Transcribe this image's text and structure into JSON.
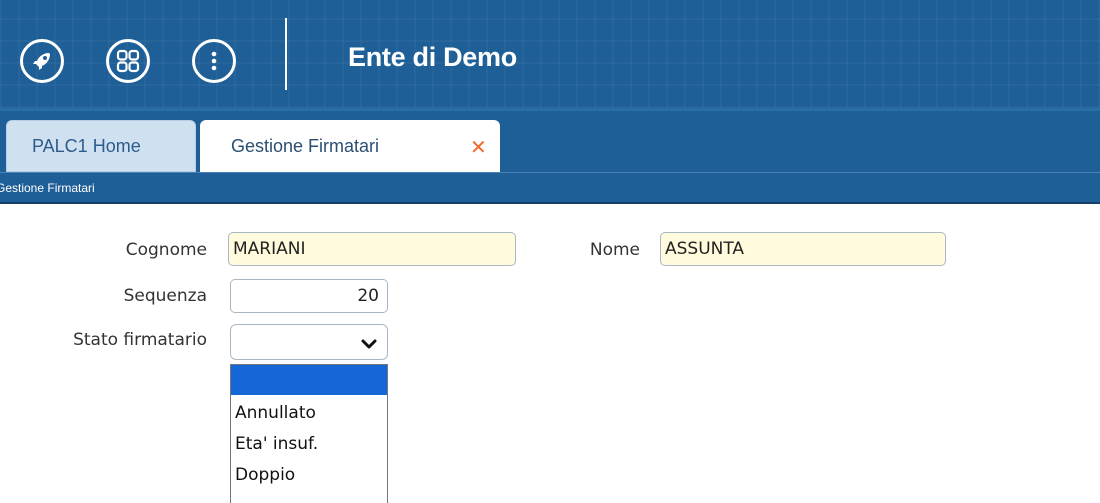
{
  "header": {
    "title": "Ente di Demo",
    "buttons": [
      {
        "icon": "rocket-icon"
      },
      {
        "icon": "apps-grid-icon"
      },
      {
        "icon": "more-vertical-icon"
      }
    ]
  },
  "tabs": [
    {
      "label": "PALC1 Home",
      "active": false
    },
    {
      "label": "Gestione Firmatari",
      "active": true,
      "closable": true
    }
  ],
  "tab_close_glyph": "✕",
  "breadcrumb": "Gestione Firmatari",
  "form": {
    "cognome_label": "Cognome",
    "cognome_value": "MARIANI",
    "nome_label": "Nome",
    "nome_value": "ASSUNTA",
    "sequenza_label": "Sequenza",
    "sequenza_value": "20",
    "stato_label": "Stato firmatario",
    "stato_value": "",
    "stato_options": [
      "",
      "Annullato",
      "Eta' insuf.",
      "Doppio"
    ]
  },
  "colors": {
    "header_bg": "#1f5f97",
    "tab_close": "#f06a2a",
    "required_field_bg": "#fffbdc",
    "selected_option": "#1566d6"
  }
}
